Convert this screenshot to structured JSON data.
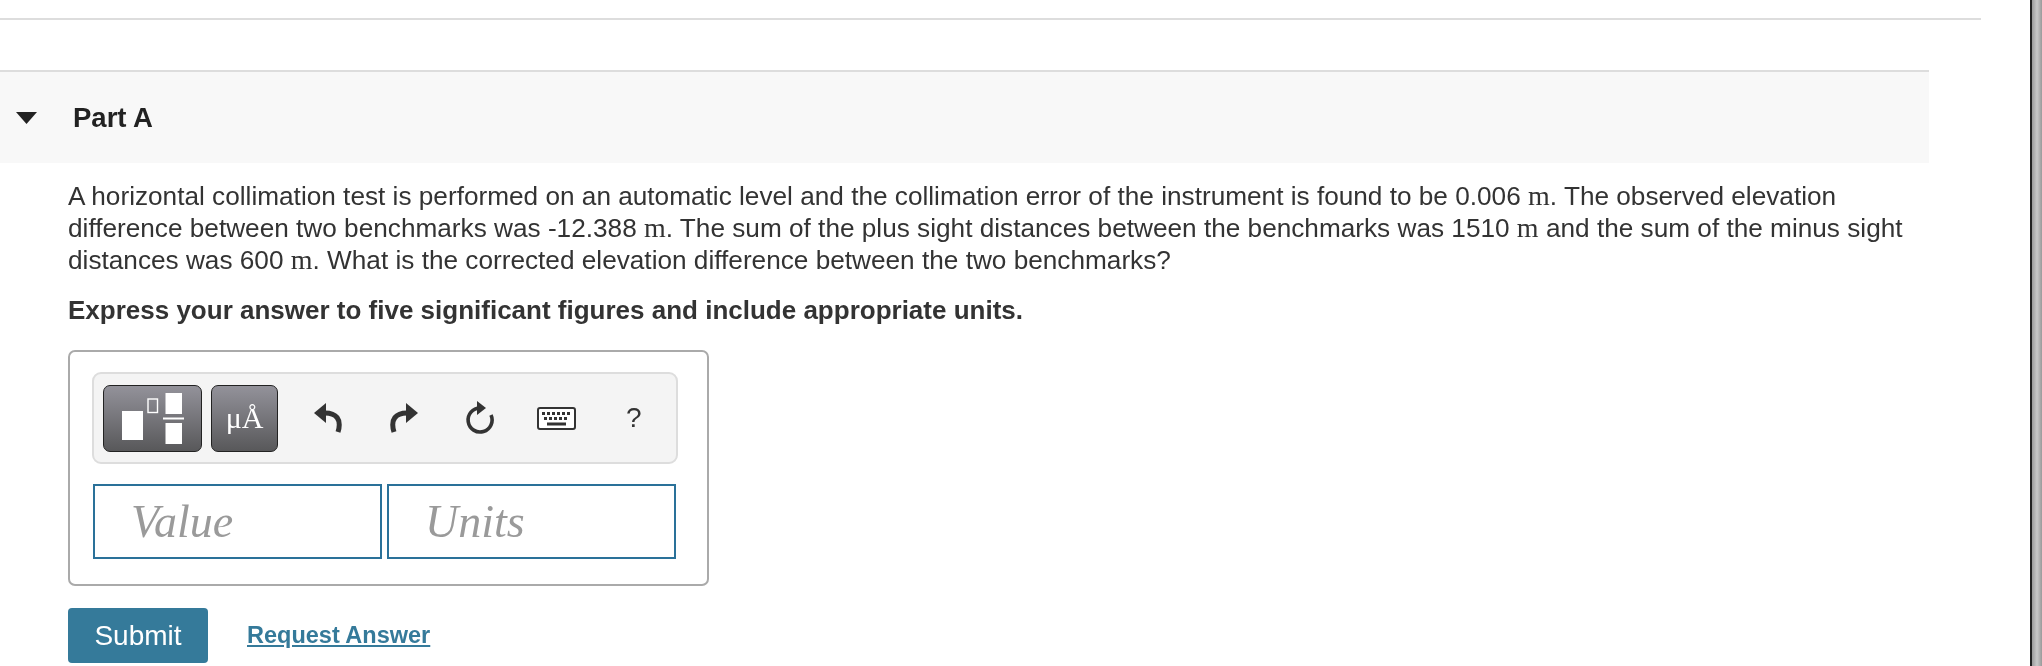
{
  "part": {
    "title": "Part A",
    "expanded": true
  },
  "question": {
    "segments": [
      {
        "kind": "text",
        "text": "A horizontal collimation test is performed on an automatic level and the collimation error of the instrument is found to be 0.006 "
      },
      {
        "kind": "math",
        "text": "m"
      },
      {
        "kind": "text",
        "text": ". The observed elevation difference between two benchmarks was -12.388 "
      },
      {
        "kind": "math",
        "text": "m"
      },
      {
        "kind": "text",
        "text": ". The sum of the plus sight distances between the benchmarks was 1510 "
      },
      {
        "kind": "math",
        "text": "m"
      },
      {
        "kind": "text",
        "text": " and the sum of the minus sight distances was 600 "
      },
      {
        "kind": "math",
        "text": "m"
      },
      {
        "kind": "text",
        "text": ". What is the corrected elevation difference between the two benchmarks?"
      }
    ]
  },
  "instructions": "Express your answer to five significant figures and include appropriate units.",
  "answer": {
    "toolbar": {
      "symbols_label": "μÅ",
      "help_label": "?"
    },
    "value_field": {
      "placeholder": "Value"
    },
    "units_field": {
      "placeholder": "Units"
    }
  },
  "actions": {
    "submit": "Submit",
    "request_answer": "Request Answer"
  }
}
